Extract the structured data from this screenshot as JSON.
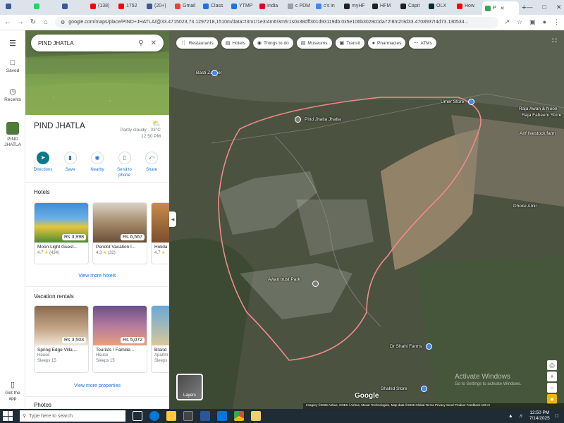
{
  "browser": {
    "tabs": [
      {
        "label": "",
        "color": "#3b5998"
      },
      {
        "label": "",
        "color": "#25d366"
      },
      {
        "label": "",
        "color": "#3b5998"
      },
      {
        "label": "(138)",
        "color": "#ff0000"
      },
      {
        "label": "1752",
        "color": "#ff0000"
      },
      {
        "label": "(20+)",
        "color": "#3b5998"
      },
      {
        "label": "Gmail",
        "color": "#ea4335"
      },
      {
        "label": "Class",
        "color": "#1a73e8"
      },
      {
        "label": "YTMP",
        "color": "#1a73e8"
      },
      {
        "label": "India",
        "color": "#e60023"
      },
      {
        "label": "c PDM",
        "color": "#9aa0a6"
      },
      {
        "label": "c's in",
        "color": "#4285f4"
      },
      {
        "label": "myHF",
        "color": "#202124"
      },
      {
        "label": "HFM",
        "color": "#202124"
      },
      {
        "label": "Capit",
        "color": "#202124"
      },
      {
        "label": "OLX",
        "color": "#002f34"
      },
      {
        "label": "How",
        "color": "#ff0000"
      },
      {
        "label": "P",
        "color": "#34a853",
        "active": true
      }
    ],
    "new_tab": "+",
    "url": "google.com/maps/place/PIND+JHATLA/@33.4715023,73.1297218,1510m/data=!3m1!1e3!4m6!3m5!1s0x38dff301d93119db:0x5e106b3028c0da72!8m2!3d33.4708937!4d73.130534..."
  },
  "rail": {
    "saved": "Saved",
    "recents": "Recents",
    "place": "PIND JHATLA",
    "get_app": "Get the app"
  },
  "panel": {
    "search_value": "PIND JHATLA",
    "title": "PIND JHATLA",
    "weather_desc": "Partly cloudy · 33°C",
    "weather_time": "12:50 PM",
    "actions": [
      {
        "label": "Directions",
        "icon": "directions-icon"
      },
      {
        "label": "Save",
        "icon": "bookmark-icon"
      },
      {
        "label": "Nearby",
        "icon": "nearby-icon"
      },
      {
        "label": "Send to phone",
        "icon": "phone-icon"
      },
      {
        "label": "Share",
        "icon": "share-icon"
      }
    ],
    "hotels_heading": "Hotels",
    "hotels": [
      {
        "name": "Moon Light Guest...",
        "price": "Rs 3,998",
        "rating": "4.7",
        "reviews": "(434)"
      },
      {
        "name": "Peridot Vacation I...",
        "price": "Rs 6,567",
        "rating": "4.3",
        "reviews": "(32)"
      },
      {
        "name": "Holida",
        "price": "",
        "rating": "4.7",
        "reviews": ""
      }
    ],
    "view_more_hotels": "View more hotels",
    "rentals_heading": "Vacation rentals",
    "rentals": [
      {
        "name": "Spring Edge Villa ...",
        "price": "Rs 3,503",
        "type": "House",
        "sleeps": "Sleeps 15"
      },
      {
        "name": "Tourists / Familie...",
        "price": "Rs 5,072",
        "type": "House",
        "sleeps": "Sleeps 15"
      },
      {
        "name": "Brand",
        "price": "",
        "type": "Apartm",
        "sleeps": "Sleeps"
      }
    ],
    "view_more_properties": "View more properties",
    "photos_heading": "Photos"
  },
  "map": {
    "chips": [
      {
        "label": "Restaurants",
        "icon": "fork-knife-icon"
      },
      {
        "label": "Hotels",
        "icon": "bed-icon"
      },
      {
        "label": "Things to do",
        "icon": "camera-icon"
      },
      {
        "label": "Museums",
        "icon": "museum-icon"
      },
      {
        "label": "Transit",
        "icon": "bus-icon"
      },
      {
        "label": "Pharmacies",
        "icon": "pill-icon"
      },
      {
        "label": "ATMs",
        "icon": "atm-icon"
      }
    ],
    "labels": {
      "basti_zaheer": "Basti Zaheer",
      "pind_jhatla": "Pind Jhatla Jhatla",
      "umer_store": "Umer Store",
      "raja_awan": "Raja Awan & Noon",
      "raja_awan_sub": "Raja Faheem Store",
      "arif_livestock": "Arif livestock farm",
      "dhoke_amir": "Dhoke Amir",
      "awan_trust": "Awan trust Park",
      "dr_shahi": "Dr Shahi Farms",
      "shahid_store": "Shahid Store"
    },
    "layers": "Layers",
    "google": "Google",
    "windows_1": "Activate Windows",
    "windows_2": "Go to Settings to activate Windows.",
    "attribution": "Imagery ©2025 Airbus, CNES / Airbus, Maxar Technologies, Map data ©2025   Global   Terms   Privacy   Send Product Feedback   100 m"
  },
  "taskbar": {
    "search_placeholder": "Type here to search",
    "time": "12:50 PM",
    "date": "7/14/2025"
  }
}
